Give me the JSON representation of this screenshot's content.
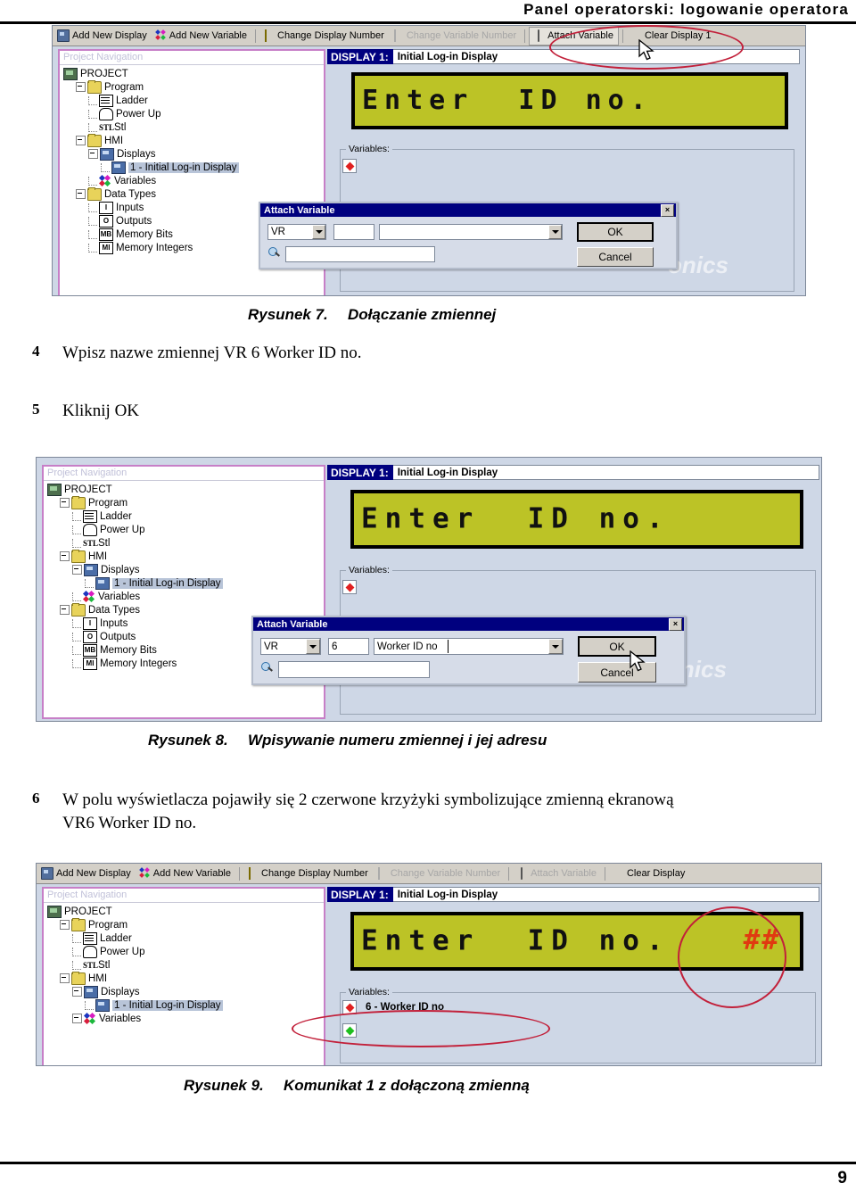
{
  "page": {
    "header_title": "Panel operatorski: logowanie operatora",
    "page_number": "9"
  },
  "steps": [
    {
      "num": "4",
      "text": "Wpisz nazwe zmiennej VR 6 Worker ID no."
    },
    {
      "num": "5",
      "text": "Kliknij OK"
    },
    {
      "num": "6",
      "text": "W polu wyświetlacza pojawiły się 2 czerwone krzyżyki symbolizujące zmienną ekranową VR6 Worker ID no."
    }
  ],
  "captions": [
    {
      "label": "Rysunek 7.",
      "text": "Dołączanie zmiennej"
    },
    {
      "label": "Rysunek 8.",
      "text": "Wpisywanie numeru zmiennej i jej adresu"
    },
    {
      "label": "Rysunek 9.",
      "text": "Komunikat 1 z dołączoną zmienną"
    }
  ],
  "toolbar": {
    "items": [
      {
        "label": "Add New Display",
        "icon": "add-display-icon",
        "state": "enabled"
      },
      {
        "label": "Add New Variable",
        "icon": "add-variable-icon",
        "state": "enabled"
      },
      {
        "label": "Change Display Number",
        "icon": "change-display-icon",
        "state": "enabled"
      },
      {
        "label": "Change Variable Number",
        "icon": "change-variable-icon",
        "state": "disabled"
      },
      {
        "label": "Attach Variable",
        "icon": "attach-variable-icon",
        "state": "highlighted"
      },
      {
        "label": "Clear Display 1",
        "icon": "clear-display-icon",
        "state": "enabled"
      }
    ],
    "items_bottom": [
      {
        "label": "Add New Display",
        "icon": "add-display-icon",
        "state": "enabled"
      },
      {
        "label": "Add New Variable",
        "icon": "add-variable-icon",
        "state": "enabled"
      },
      {
        "label": "Change Display Number",
        "icon": "change-display-icon",
        "state": "enabled"
      },
      {
        "label": "Change Variable Number",
        "icon": "change-variable-icon",
        "state": "disabled"
      },
      {
        "label": "Attach Variable",
        "icon": "attach-variable-icon",
        "state": "disabled"
      },
      {
        "label": "Clear Display",
        "icon": "clear-display-icon",
        "state": "enabled"
      }
    ]
  },
  "nav": {
    "title": "Project Navigation",
    "tree": [
      {
        "label": "PROJECT",
        "depth": 0,
        "icon": "project-icon",
        "expander": "none",
        "selected": false
      },
      {
        "label": "Program",
        "depth": 1,
        "icon": "folder-icon",
        "expander": "collapse",
        "selected": false
      },
      {
        "label": "Ladder",
        "depth": 2,
        "icon": "ladder-icon",
        "expander": "leaf",
        "selected": false
      },
      {
        "label": "Power Up",
        "depth": 2,
        "icon": "power-up-icon",
        "expander": "leaf",
        "selected": false
      },
      {
        "label": "Stl",
        "depth": 2,
        "icon": "stl-icon",
        "expander": "leaf",
        "selected": false
      },
      {
        "label": "HMI",
        "depth": 1,
        "icon": "folder-icon",
        "expander": "collapse",
        "selected": false
      },
      {
        "label": "Displays",
        "depth": 2,
        "icon": "displays-icon",
        "expander": "collapse",
        "selected": false
      },
      {
        "label": "1 - Initial Log-in Display",
        "depth": 3,
        "icon": "display-icon",
        "expander": "leaf",
        "selected": true
      },
      {
        "label": "Variables",
        "depth": 2,
        "icon": "variables-icon",
        "expander": "leaf",
        "selected": false
      },
      {
        "label": "Data Types",
        "depth": 1,
        "icon": "folder-icon",
        "expander": "collapse",
        "selected": false
      },
      {
        "label": "Inputs",
        "depth": 2,
        "icon": "inputs-icon",
        "expander": "leaf",
        "selected": false
      },
      {
        "label": "Outputs",
        "depth": 2,
        "icon": "outputs-icon",
        "expander": "leaf",
        "selected": false
      },
      {
        "label": "Memory Bits",
        "depth": 2,
        "icon": "memory-bits-icon",
        "expander": "leaf",
        "selected": false
      },
      {
        "label": "Memory Integers",
        "depth": 2,
        "icon": "memory-int-icon",
        "expander": "leaf",
        "selected": false
      }
    ],
    "tree_bottom": [
      {
        "label": "PROJECT",
        "depth": 0,
        "icon": "project-icon",
        "expander": "none",
        "selected": false
      },
      {
        "label": "Program",
        "depth": 1,
        "icon": "folder-icon",
        "expander": "collapse",
        "selected": false
      },
      {
        "label": "Ladder",
        "depth": 2,
        "icon": "ladder-icon",
        "expander": "leaf",
        "selected": false
      },
      {
        "label": "Power Up",
        "depth": 2,
        "icon": "power-up-icon",
        "expander": "leaf",
        "selected": false
      },
      {
        "label": "Stl",
        "depth": 2,
        "icon": "stl-icon",
        "expander": "leaf",
        "selected": false
      },
      {
        "label": "HMI",
        "depth": 1,
        "icon": "folder-icon",
        "expander": "collapse",
        "selected": false
      },
      {
        "label": "Displays",
        "depth": 2,
        "icon": "displays-icon",
        "expander": "collapse",
        "selected": false
      },
      {
        "label": "1 - Initial Log-in Display",
        "depth": 3,
        "icon": "display-icon",
        "expander": "leaf",
        "selected": true
      },
      {
        "label": "Variables",
        "depth": 2,
        "icon": "variables-icon",
        "expander": "collapse",
        "selected": false
      }
    ]
  },
  "display_editor": {
    "tag": "DISPLAY 1:",
    "name": "Initial Log-in Display",
    "lcd_text": "Enter  ID no.",
    "lcd_variable_marks": "##",
    "variables_legend": "Variables:",
    "variable_rows_empty": [
      {
        "color": "#e02020",
        "label": ""
      },
      {
        "color": "#1fbf1f",
        "label": ""
      }
    ],
    "variable_rows_filled": [
      {
        "color": "#e02020",
        "label": "6 - Worker ID no"
      },
      {
        "color": "#1fbf1f",
        "label": ""
      }
    ],
    "watermark": "onics"
  },
  "attach_dialog_empty": {
    "title": "Attach Variable",
    "close_label": "×",
    "type_value": "VR",
    "number_value": "",
    "name_value": "",
    "address_value": "",
    "ok_label": "OK",
    "cancel_label": "Cancel"
  },
  "attach_dialog_filled": {
    "title": "Attach Variable",
    "close_label": "×",
    "type_value": "VR",
    "number_value": "6",
    "name_value": "Worker ID no",
    "address_value": "",
    "ok_label": "OK",
    "cancel_label": "Cancel"
  },
  "annotations": {
    "ellipse_attach_variable": "attach-variable-toolbar-highlight",
    "ellipse_hash_marks": "lcd-variable-marks-highlight",
    "ellipse_variable_row": "variable-row-highlight"
  },
  "colors": {
    "lcd_background": "#bcc326",
    "lcd_text": "#111111",
    "hash_red": "#e03a10",
    "annotation_red": "#c2203a",
    "titlebar_blue": "#00007f",
    "nav_border_pink": "#c77fc7",
    "editor_bg": "#ced7e6"
  }
}
